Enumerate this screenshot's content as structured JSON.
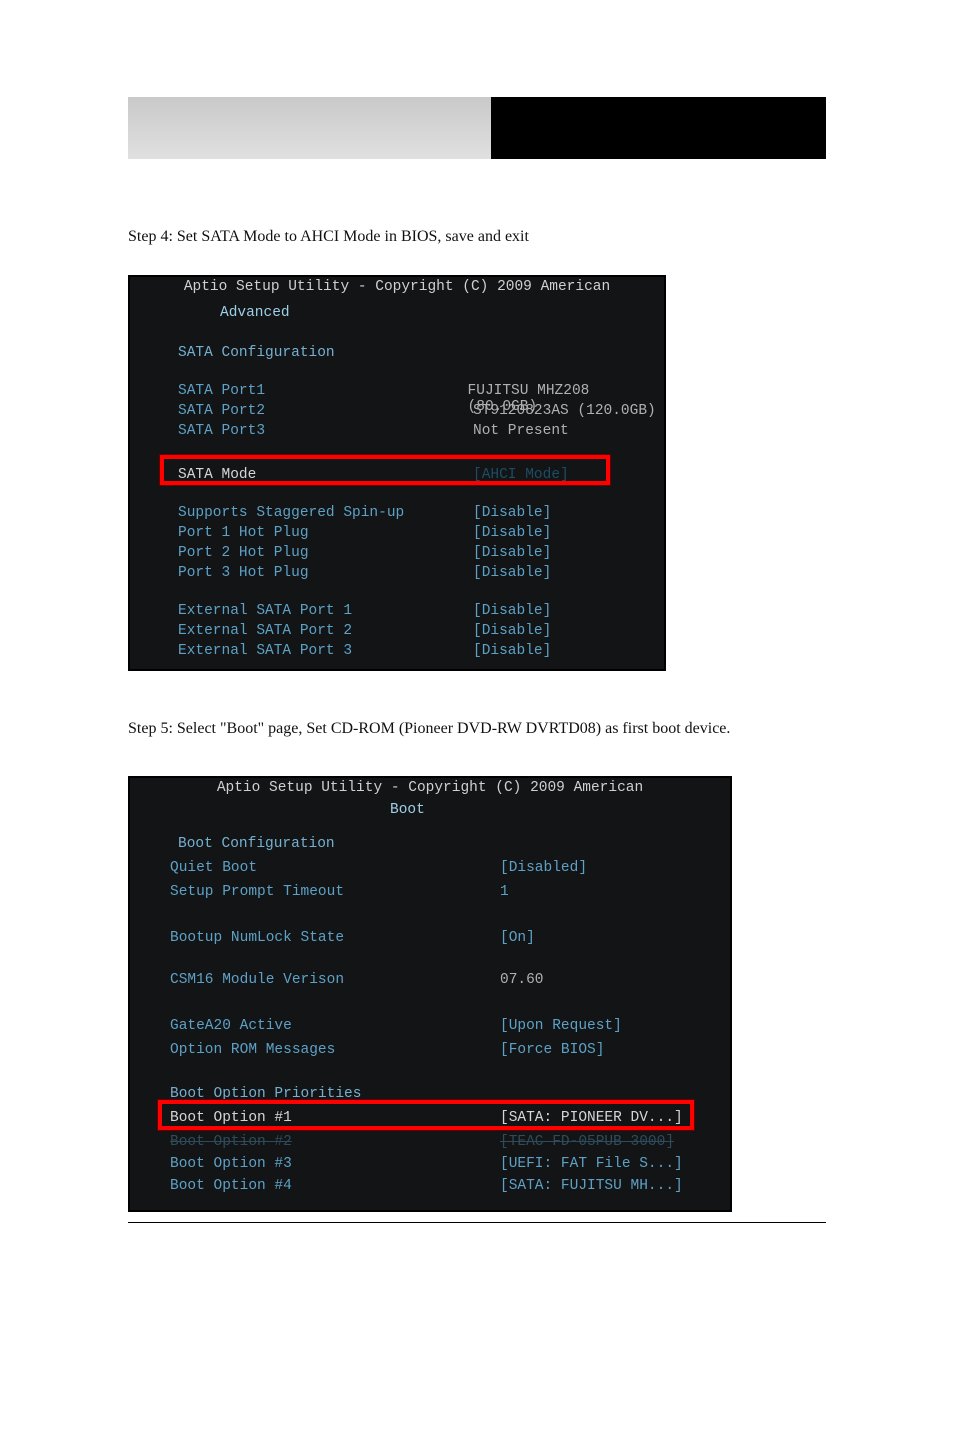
{
  "paragraphs": {
    "p1": "Step 4: Set SATA Mode to AHCI Mode in BIOS, save and exit",
    "p2": "Step 5: Select \"Boot\" page, Set CD-ROM (Pioneer DVD-RW DVRTD08) as first boot device."
  },
  "bios1": {
    "title": "Aptio Setup Utility - Copyright (C) 2009 American",
    "tab": "Advanced",
    "section": "SATA Configuration",
    "rows": {
      "p1": {
        "label": "SATA Port1",
        "value": "FUJITSU MHZ208 (80.0GB)"
      },
      "p2": {
        "label": "SATA Port2",
        "value": "ST9120823AS   (120.0GB)"
      },
      "p3": {
        "label": "SATA Port3",
        "value": "Not Present"
      },
      "mode": {
        "label": "SATA Mode",
        "value": "[AHCI Mode]"
      },
      "stag": {
        "label": "Supports Staggered Spin-up",
        "value": "[Disable]"
      },
      "h1": {
        "label": "Port 1 Hot Plug",
        "value": "[Disable]"
      },
      "h2": {
        "label": "Port 2 Hot Plug",
        "value": "[Disable]"
      },
      "h3": {
        "label": "Port 3 Hot Plug",
        "value": "[Disable]"
      },
      "e1": {
        "label": "External SATA Port 1",
        "value": "[Disable]"
      },
      "e2": {
        "label": "External SATA Port 2",
        "value": "[Disable]"
      },
      "e3": {
        "label": "External SATA Port 3",
        "value": "[Disable]"
      }
    }
  },
  "bios2": {
    "title": "Aptio Setup Utility - Copyright (C) 2009 American",
    "tab": "Boot",
    "section": "Boot Configuration",
    "rows": {
      "qb": {
        "label": "Quiet Boot",
        "value": "[Disabled]"
      },
      "spt": {
        "label": "Setup Prompt Timeout",
        "value": "1"
      },
      "numl": {
        "label": "Bootup NumLock State",
        "value": "[On]"
      },
      "csm": {
        "label": "CSM16 Module Verison",
        "value": "07.60"
      },
      "ga20": {
        "label": "GateA20 Active",
        "value": "[Upon Request]"
      },
      "orom": {
        "label": "Option ROM Messages",
        "value": "[Force BIOS]"
      }
    },
    "boot_priorities_title": "Boot Option Priorities",
    "boot_options": {
      "b1": {
        "label": "Boot Option #1",
        "value": "[SATA: PIONEER DV...]"
      },
      "b2": {
        "label": "Boot Option #2",
        "value": "[TEAC FD-05PUB 3000]"
      },
      "b3": {
        "label": "Boot Option #3",
        "value": "[UEFI: FAT File S...]"
      },
      "b4": {
        "label": "Boot Option #4",
        "value": "[SATA: FUJITSU MH...]"
      }
    }
  }
}
